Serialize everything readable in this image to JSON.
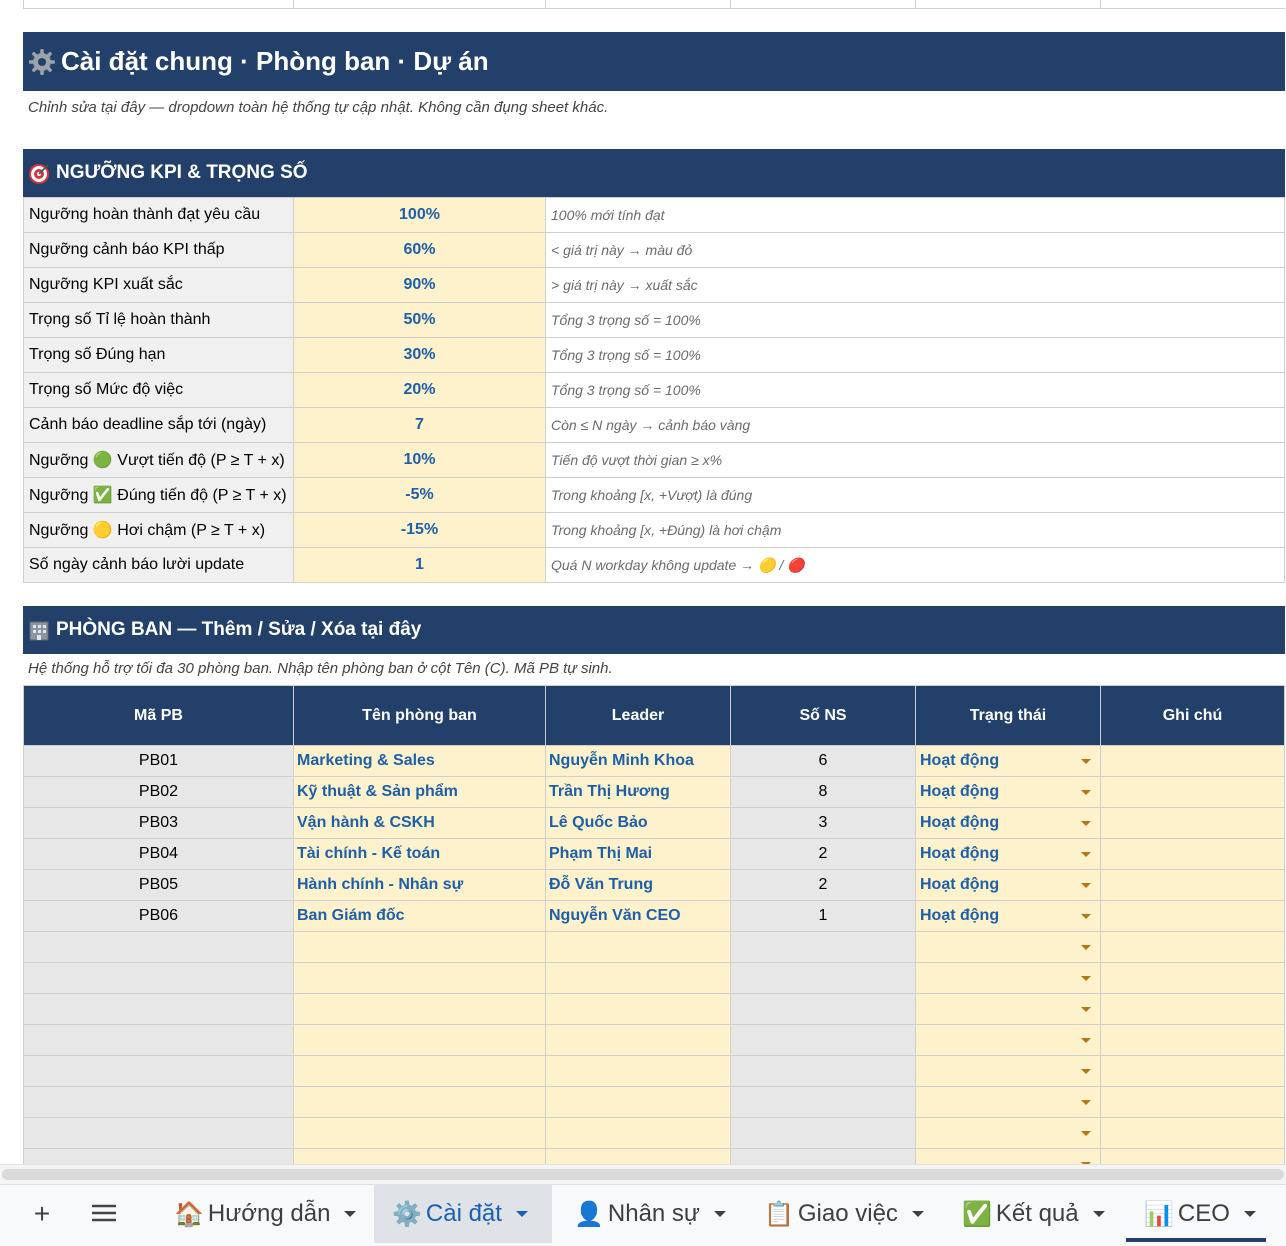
{
  "header": {
    "title": "Cài đặt chung · Phòng ban · Dự án",
    "subtitle": "Chỉnh sửa tại đây — dropdown toàn hệ thống tự cập nhật. Không cần đụng sheet khác."
  },
  "kpi": {
    "title": "NGƯỠNG KPI & TRỌNG SỐ",
    "rows": [
      {
        "label": "Ngưỡng hoàn thành đạt yêu cầu",
        "value": "100%",
        "note": "100% mới tính đạt"
      },
      {
        "label": "Ngưỡng cảnh báo KPI thấp",
        "value": "60%",
        "note": "< giá trị này → màu đỏ"
      },
      {
        "label": "Ngưỡng KPI xuất sắc",
        "value": "90%",
        "note": "> giá trị này → xuất sắc"
      },
      {
        "label": "Trọng số Tỉ lệ hoàn thành",
        "value": "50%",
        "note": "Tổng 3 trọng số = 100%"
      },
      {
        "label": "Trọng số Đúng hạn",
        "value": "30%",
        "note": "Tổng 3 trọng số = 100%"
      },
      {
        "label": "Trọng số Mức độ việc",
        "value": "20%",
        "note": "Tổng 3 trọng số = 100%"
      },
      {
        "label": "Cảnh báo deadline sắp tới (ngày)",
        "value": "7",
        "note": "Còn ≤ N ngày → cảnh báo vàng"
      },
      {
        "label": "Ngưỡng 🟢 Vượt tiến độ (P ≥ T + x)",
        "value": "10%",
        "note": "Tiến độ vượt thời gian ≥ x%"
      },
      {
        "label": "Ngưỡng ✅ Đúng tiến độ (P ≥ T + x)",
        "value": "-5%",
        "note": "Trong khoảng [x, +Vượt) là đúng"
      },
      {
        "label": "Ngưỡng 🟡 Hơi chậm (P ≥ T + x)",
        "value": "-15%",
        "note": "Trong khoảng [x, +Đúng) là hơi chậm"
      },
      {
        "label": "Số ngày cảnh báo lười update",
        "value": "1",
        "note": "Quá N workday không update → 🟡 / 🔴"
      }
    ]
  },
  "departments": {
    "title": "PHÒNG BAN — Thêm / Sửa / Xóa tại đây",
    "subtitle": "Hệ thống hỗ trợ tối đa 30 phòng ban. Nhập tên phòng ban ở cột Tên (C). Mã PB tự sinh.",
    "headers": [
      "Mã PB",
      "Tên phòng ban",
      "Leader",
      "Số NS",
      "Trạng thái",
      "Ghi chú"
    ],
    "rows": [
      {
        "code": "PB01",
        "name": "Marketing & Sales",
        "leader": "Nguyễn Minh Khoa",
        "count": "6",
        "status": "Hoạt động",
        "note": ""
      },
      {
        "code": "PB02",
        "name": "Kỹ thuật & Sản phẩm",
        "leader": "Trần Thị Hương",
        "count": "8",
        "status": "Hoạt động",
        "note": ""
      },
      {
        "code": "PB03",
        "name": "Vận hành & CSKH",
        "leader": "Lê Quốc Bảo",
        "count": "3",
        "status": "Hoạt động",
        "note": ""
      },
      {
        "code": "PB04",
        "name": "Tài chính - Kế toán",
        "leader": "Phạm Thị Mai",
        "count": "2",
        "status": "Hoạt động",
        "note": ""
      },
      {
        "code": "PB05",
        "name": "Hành chính - Nhân sự",
        "leader": "Đỗ Văn Trung",
        "count": "2",
        "status": "Hoạt động",
        "note": ""
      },
      {
        "code": "PB06",
        "name": "Ban Giám đốc",
        "leader": "Nguyễn Văn CEO",
        "count": "1",
        "status": "Hoạt động",
        "note": ""
      },
      {
        "code": "",
        "name": "",
        "leader": "",
        "count": "",
        "status": "",
        "note": ""
      },
      {
        "code": "",
        "name": "",
        "leader": "",
        "count": "",
        "status": "",
        "note": ""
      },
      {
        "code": "",
        "name": "",
        "leader": "",
        "count": "",
        "status": "",
        "note": ""
      },
      {
        "code": "",
        "name": "",
        "leader": "",
        "count": "",
        "status": "",
        "note": ""
      },
      {
        "code": "",
        "name": "",
        "leader": "",
        "count": "",
        "status": "",
        "note": ""
      },
      {
        "code": "",
        "name": "",
        "leader": "",
        "count": "",
        "status": "",
        "note": ""
      },
      {
        "code": "",
        "name": "",
        "leader": "",
        "count": "",
        "status": "",
        "note": ""
      },
      {
        "code": "",
        "name": "",
        "leader": "",
        "count": "",
        "status": "",
        "note": ""
      }
    ]
  },
  "tabs": [
    {
      "icon": "🏠",
      "label": "Hướng dẫn",
      "active": false
    },
    {
      "icon": "⚙️",
      "label": "Cài đặt",
      "active": true
    },
    {
      "icon": "👤",
      "label": "Nhân sự",
      "active": false
    },
    {
      "icon": "📋",
      "label": "Giao việc",
      "active": false
    },
    {
      "icon": "✅",
      "label": "Kết quả",
      "active": false
    },
    {
      "icon": "📊",
      "label": "CEO",
      "active": false
    }
  ],
  "toolbar": {
    "add_symbol": "+",
    "menu_symbol": "≡"
  },
  "icons": {
    "header": "gear-icon",
    "kpi": "target-icon",
    "departments": "building-icon"
  },
  "colors": {
    "header_bg": "#22406a",
    "value_bg": "#fdf2cc",
    "value_text": "#1f5fa8",
    "label_bg": "#f0f0f0"
  }
}
